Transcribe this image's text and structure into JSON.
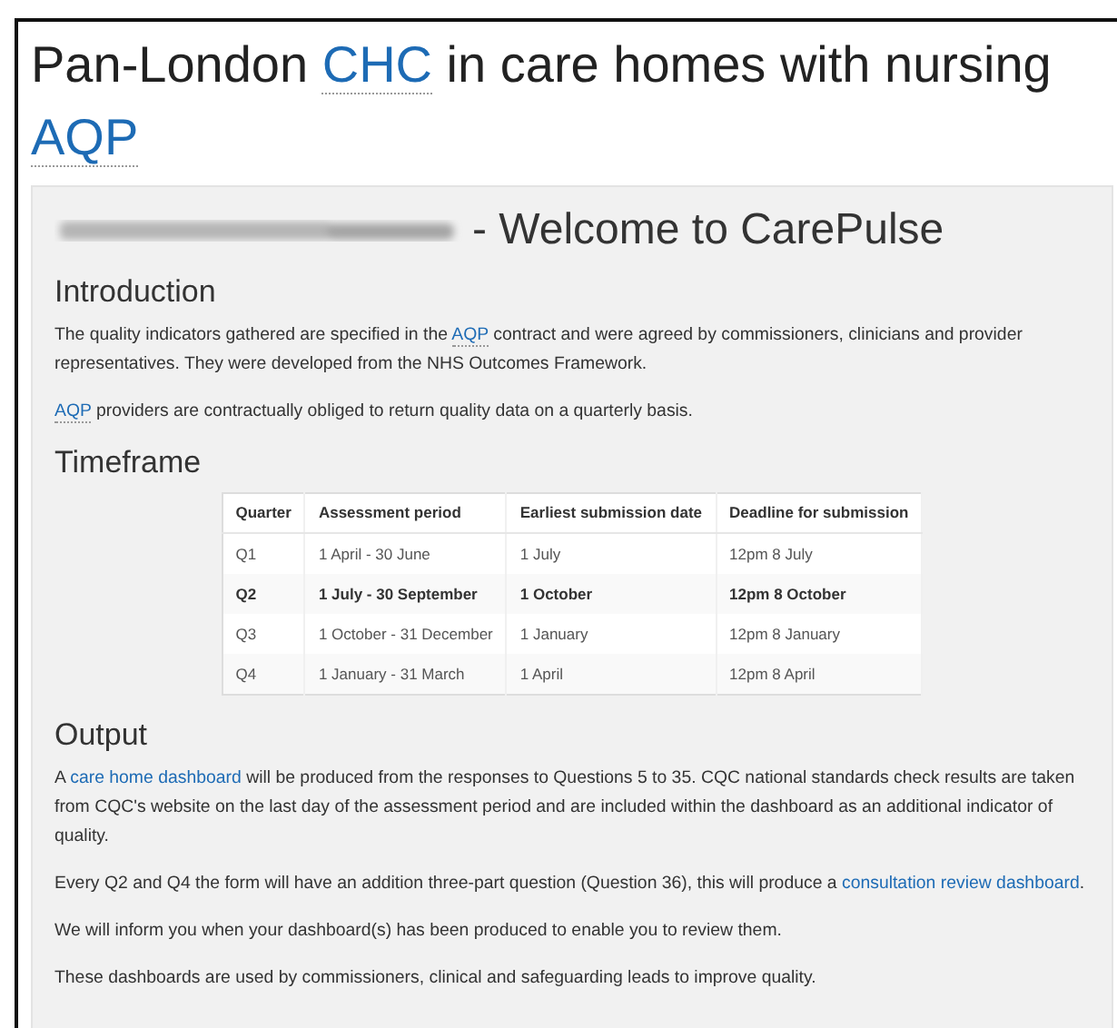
{
  "page_title": [
    {
      "kind": "text",
      "text": "Pan-London "
    },
    {
      "kind": "abbr",
      "text": "CHC"
    },
    {
      "kind": "text",
      "text": " in care homes with nursing "
    },
    {
      "kind": "abbr",
      "text": "AQP"
    }
  ],
  "welcome": {
    "redacted": true,
    "text": "- Welcome to CarePulse"
  },
  "sections": [
    {
      "heading": "Introduction",
      "paragraphs": [
        [
          {
            "kind": "text",
            "text": "The quality indicators gathered are specified in the "
          },
          {
            "kind": "abbr",
            "text": "AQP"
          },
          {
            "kind": "text",
            "text": " contract and were agreed by commissioners, clinicians and provider representatives. They were developed from the NHS Outcomes Framework."
          }
        ],
        [
          {
            "kind": "abbr",
            "text": "AQP"
          },
          {
            "kind": "text",
            "text": " providers are contractually obliged to return quality data on a quarterly basis."
          }
        ]
      ]
    },
    {
      "heading": "Timeframe",
      "table": {
        "columns": [
          "Quarter",
          "Assessment period",
          "Earliest submission date",
          "Deadline for submission"
        ],
        "rows": [
          {
            "cells": [
              "Q1",
              "1 April - 30 June",
              "1 July",
              "12pm 8 July"
            ],
            "current": false
          },
          {
            "cells": [
              "Q2",
              "1 July - 30 September",
              "1 October",
              "12pm 8 October"
            ],
            "current": true
          },
          {
            "cells": [
              "Q3",
              "1 October - 31 December",
              "1 January",
              "12pm 8 January"
            ],
            "current": false
          },
          {
            "cells": [
              "Q4",
              "1 January - 31 March",
              "1 April",
              "12pm 8 April"
            ],
            "current": false
          }
        ]
      }
    },
    {
      "heading": "Output",
      "paragraphs": [
        [
          {
            "kind": "text",
            "text": "A "
          },
          {
            "kind": "link",
            "text": "care home dashboard"
          },
          {
            "kind": "text",
            "text": " will be produced from the responses to Questions 5 to 35. CQC national standards check results are taken from CQC's website on the last day of the assessment period and are included within the dashboard as an additional indicator of quality."
          }
        ],
        [
          {
            "kind": "text",
            "text": "Every Q2 and Q4 the form will have an addition three-part question (Question 36), this will produce a "
          },
          {
            "kind": "link",
            "text": "consultation review dashboard"
          },
          {
            "kind": "text",
            "text": "."
          }
        ],
        [
          {
            "kind": "text",
            "text": "We will inform you when your dashboard(s) has been produced to enable you to review them."
          }
        ],
        [
          {
            "kind": "text",
            "text": "These dashboards are used by commissioners, clinical and safeguarding leads to improve quality."
          }
        ]
      ]
    }
  ]
}
